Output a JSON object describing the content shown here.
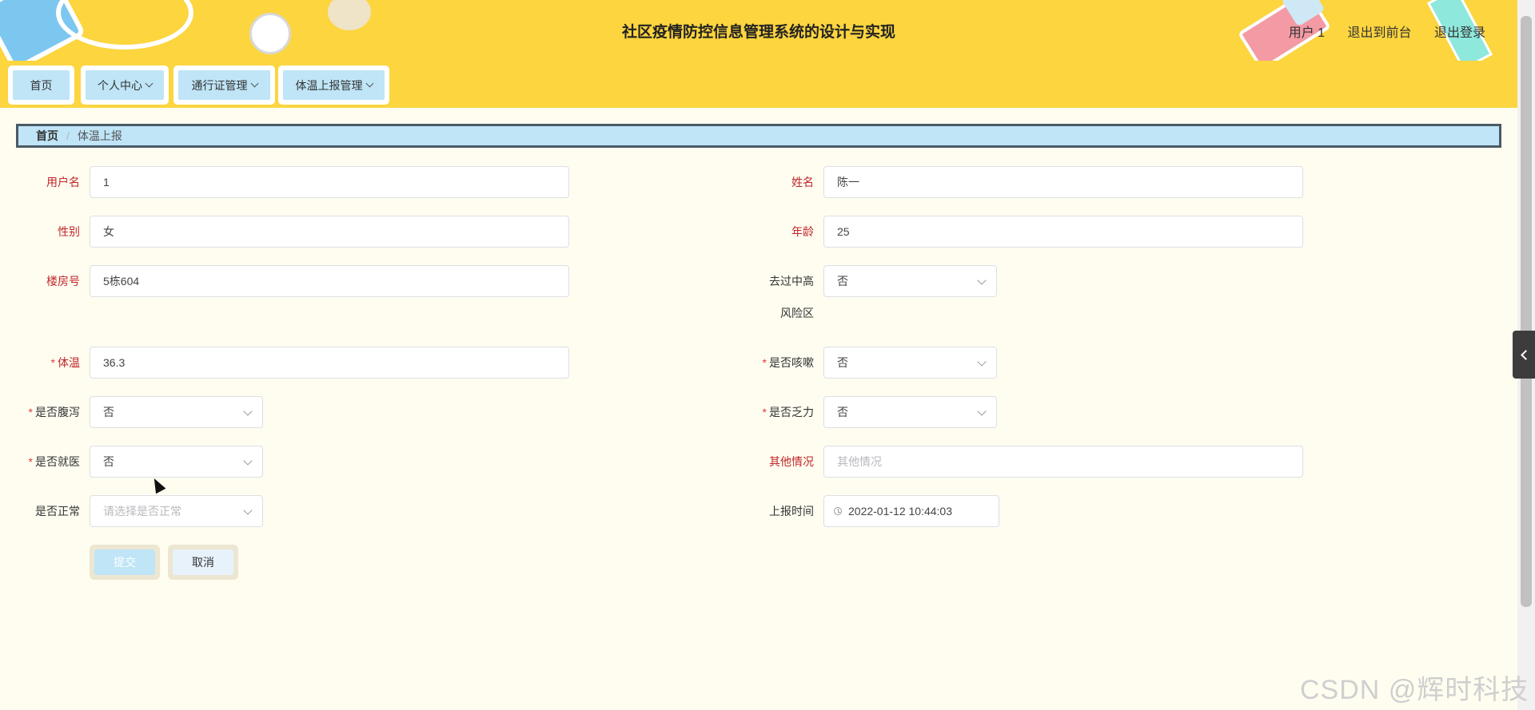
{
  "header": {
    "title": "社区疫情防控信息管理系统的设计与实现",
    "user_label": "用户 1",
    "front_link": "退出到前台",
    "logout_link": "退出登录"
  },
  "menu": [
    {
      "label": "首页"
    },
    {
      "label": "个人中心"
    },
    {
      "label": "通行证管理"
    },
    {
      "label": "体温上报管理"
    }
  ],
  "breadcrumb": {
    "home": "首页",
    "current": "体温上报"
  },
  "form": {
    "username": {
      "label": "用户名",
      "value": "1"
    },
    "name": {
      "label": "姓名",
      "value": "陈一"
    },
    "gender": {
      "label": "性别",
      "value": "女"
    },
    "age": {
      "label": "年龄",
      "value": "25"
    },
    "building": {
      "label": "楼房号",
      "value": "5栋604"
    },
    "risk_area": {
      "label_line1": "去过中高",
      "label_line2": "风险区",
      "value": "否"
    },
    "temperature": {
      "required": "*",
      "label": "体温",
      "value": "36.3"
    },
    "cough": {
      "required": "*",
      "label": "是否咳嗽",
      "value": "否"
    },
    "diarrhea": {
      "required": "*",
      "label": "是否腹泻",
      "value": "否"
    },
    "fatigue": {
      "required": "*",
      "label": "是否乏力",
      "value": "否"
    },
    "medical": {
      "required": "*",
      "label": "是否就医",
      "value": "否"
    },
    "other": {
      "label": "其他情况",
      "placeholder": "其他情况"
    },
    "normal": {
      "label": "是否正常",
      "placeholder": "请选择是否正常"
    },
    "report_time": {
      "label": "上报时间",
      "value": "2022-01-12 10:44:03"
    }
  },
  "buttons": {
    "submit": "提交",
    "cancel": "取消"
  },
  "watermark": "CSDN @辉时科技"
}
